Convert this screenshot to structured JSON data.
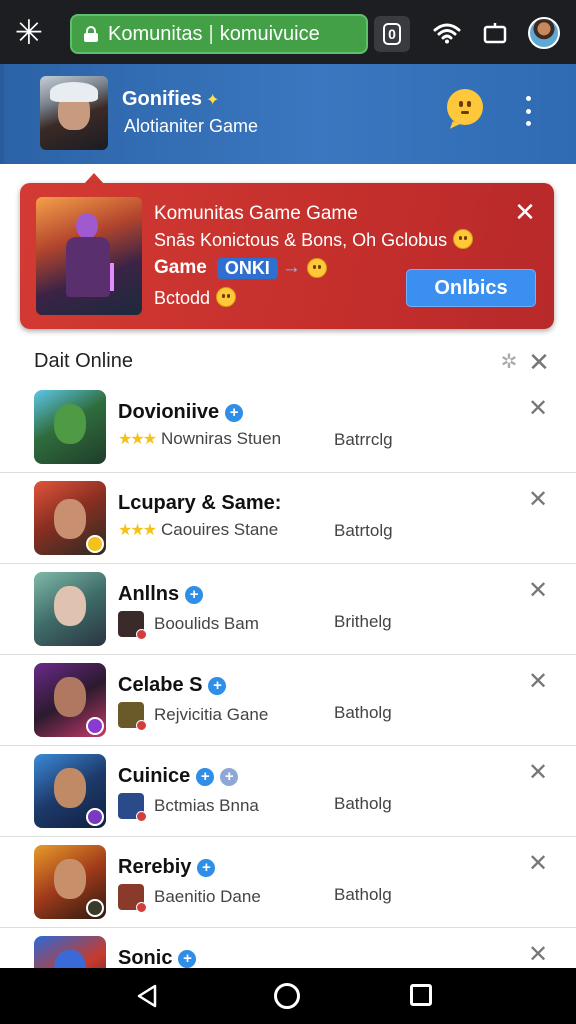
{
  "browser": {
    "url_left": "Komunitas",
    "url_right": "komuivuice",
    "tab_count": "0"
  },
  "header": {
    "title": "Gonifies",
    "subtitle": "Alotianiter Game"
  },
  "promo": {
    "line1": "Komunitas Game Game",
    "line2": "Snās Konictous & Bons, Oh Gclobus",
    "line3_prefix": "Game",
    "line3_chip": "ONKI",
    "line4": "Bctodd",
    "button_label": "Onlbics"
  },
  "list_header": {
    "title": "Dait Online"
  },
  "list_items": [
    {
      "title": "Dovioniive",
      "verified": 1,
      "stars": "★★★",
      "subtitle": "Nowniras Stuen",
      "tag": "Batrrclg",
      "icon": "soldier-game-icon"
    },
    {
      "title": "Lcupary & Same:",
      "verified": 0,
      "stars": "★★★",
      "subtitle": "Caouires Stane",
      "tag": "Batrtolg",
      "icon": "cowboy-game-icon"
    },
    {
      "title": "Anllns",
      "verified": 1,
      "stars": "",
      "subtitle": "Booulids Bam",
      "tag": "Brithelg",
      "icon": "white-hair-hero-icon"
    },
    {
      "title": "Celabe S",
      "verified": 1,
      "stars": "",
      "subtitle": "Rejvicitia Gane",
      "tag": "Batholg",
      "icon": "dark-heroine-icon"
    },
    {
      "title": "Cuinice",
      "verified": 2,
      "stars": "",
      "subtitle": "Bctmias Bnna",
      "tag": "Batholg",
      "icon": "warrior-game-icon"
    },
    {
      "title": "Rerebiy",
      "verified": 1,
      "stars": "",
      "subtitle": "Baenitio Dane",
      "tag": "Batholg",
      "icon": "ninja-game-icon"
    },
    {
      "title": "Sonic",
      "verified": 1,
      "stars": "",
      "subtitle": "",
      "tag": "",
      "icon": "sonic-game-icon"
    }
  ],
  "colors": {
    "header_blue": "#3a77c0",
    "promo_red": "#c42f2c",
    "url_green": "#43a047",
    "button_blue": "#3a8ff0",
    "verified_blue": "#2f8ee8"
  }
}
